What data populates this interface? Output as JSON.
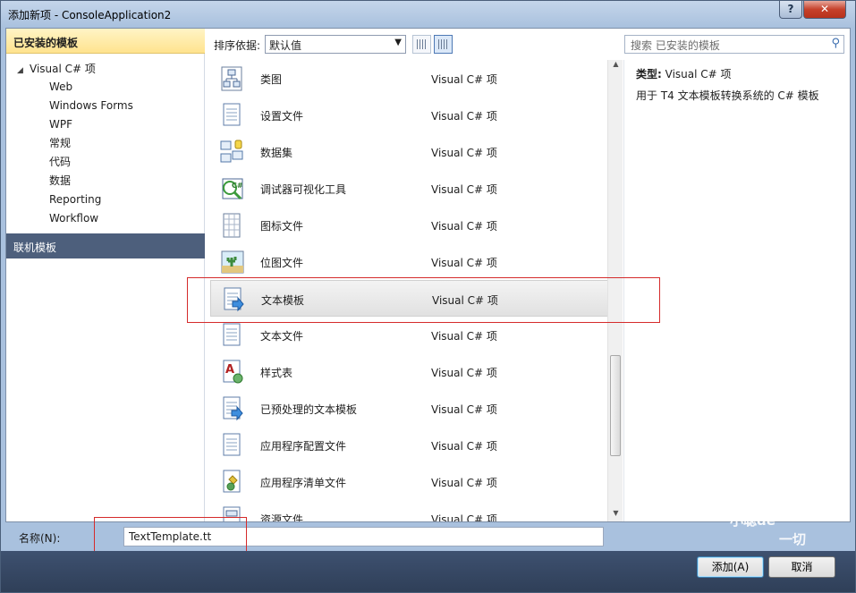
{
  "window": {
    "title": "添加新项 - ConsoleApplication2",
    "help_label": "?",
    "close_label": "✕"
  },
  "left": {
    "installed_label": "已安装的模板",
    "root_label": "Visual C# 项",
    "children": [
      "Web",
      "Windows Forms",
      "WPF",
      "常规",
      "代码",
      "数据",
      "Reporting",
      "Workflow"
    ],
    "online_label": "联机模板"
  },
  "toolbar": {
    "sort_label": "排序依据:",
    "sort_value": "默认值",
    "search_placeholder": "搜索 已安装的模板"
  },
  "items": [
    {
      "name": "类图",
      "type": "Visual C# 项",
      "icon": "class-diagram-icon"
    },
    {
      "name": "设置文件",
      "type": "Visual C# 项",
      "icon": "settings-file-icon"
    },
    {
      "name": "数据集",
      "type": "Visual C# 项",
      "icon": "dataset-icon"
    },
    {
      "name": "调试器可视化工具",
      "type": "Visual C# 项",
      "icon": "debugger-visualizer-icon"
    },
    {
      "name": "图标文件",
      "type": "Visual C# 项",
      "icon": "icon-file-icon"
    },
    {
      "name": "位图文件",
      "type": "Visual C# 项",
      "icon": "bitmap-file-icon"
    },
    {
      "name": "文本模板",
      "type": "Visual C# 项",
      "icon": "text-template-icon",
      "selected": true
    },
    {
      "name": "文本文件",
      "type": "Visual C# 项",
      "icon": "text-file-icon"
    },
    {
      "name": "样式表",
      "type": "Visual C# 项",
      "icon": "stylesheet-icon"
    },
    {
      "name": "已预处理的文本模板",
      "type": "Visual C# 项",
      "icon": "preprocessed-template-icon"
    },
    {
      "name": "应用程序配置文件",
      "type": "Visual C# 项",
      "icon": "app-config-icon"
    },
    {
      "name": "应用程序清单文件",
      "type": "Visual C# 项",
      "icon": "app-manifest-icon"
    },
    {
      "name": "资源文件",
      "type": "Visual C# 项",
      "icon": "resource-file-icon"
    }
  ],
  "detail": {
    "type_label": "类型:",
    "type_value": "Visual C# 项",
    "description": "用于 T4 文本模板转换系统的 C# 模板"
  },
  "bottom": {
    "name_label": "名称(N):",
    "name_value": "TextTemplate.tt",
    "add_label": "添加(A)",
    "cancel_label": "取消"
  },
  "watermark": {
    "line1": "小聪",
    "line2": "dé",
    "line3": "一切"
  },
  "colors": {
    "selection_box": "#d52b2b",
    "online_header": "#4d5f7c",
    "installed_header": "#ffe38e"
  }
}
